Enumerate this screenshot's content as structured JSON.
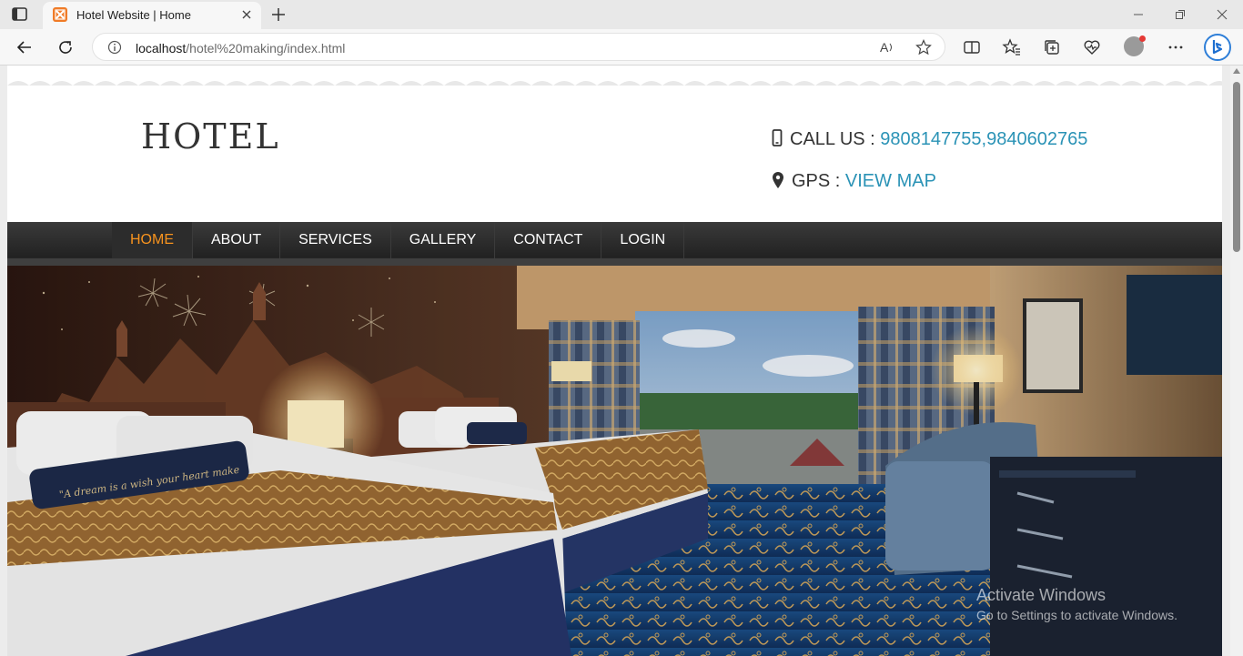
{
  "browser": {
    "tab_title": "Hotel Website | Home",
    "url_host": "localhost",
    "url_path": "/hotel%20making/index.html"
  },
  "site": {
    "logo": "HOTEL",
    "call_label": "CALL US : ",
    "call_numbers": "9808147755,9840602765",
    "gps_label": "GPS : ",
    "gps_link": "VIEW MAP",
    "accent_color": "#2b93b6",
    "active_menu_color": "#f7931e"
  },
  "menu": [
    {
      "label": "HOME",
      "active": true
    },
    {
      "label": "ABOUT",
      "active": false
    },
    {
      "label": "SERVICES",
      "active": false
    },
    {
      "label": "GALLERY",
      "active": false
    },
    {
      "label": "CONTACT",
      "active": false
    },
    {
      "label": "LOGIN",
      "active": false
    }
  ],
  "hero": {
    "image_subject": "hotel-room-photo",
    "pillow_text": "\"A dream is a wish your heart make"
  },
  "watermark": {
    "line1": "Activate Windows",
    "line2": "Go to Settings to activate Windows."
  }
}
